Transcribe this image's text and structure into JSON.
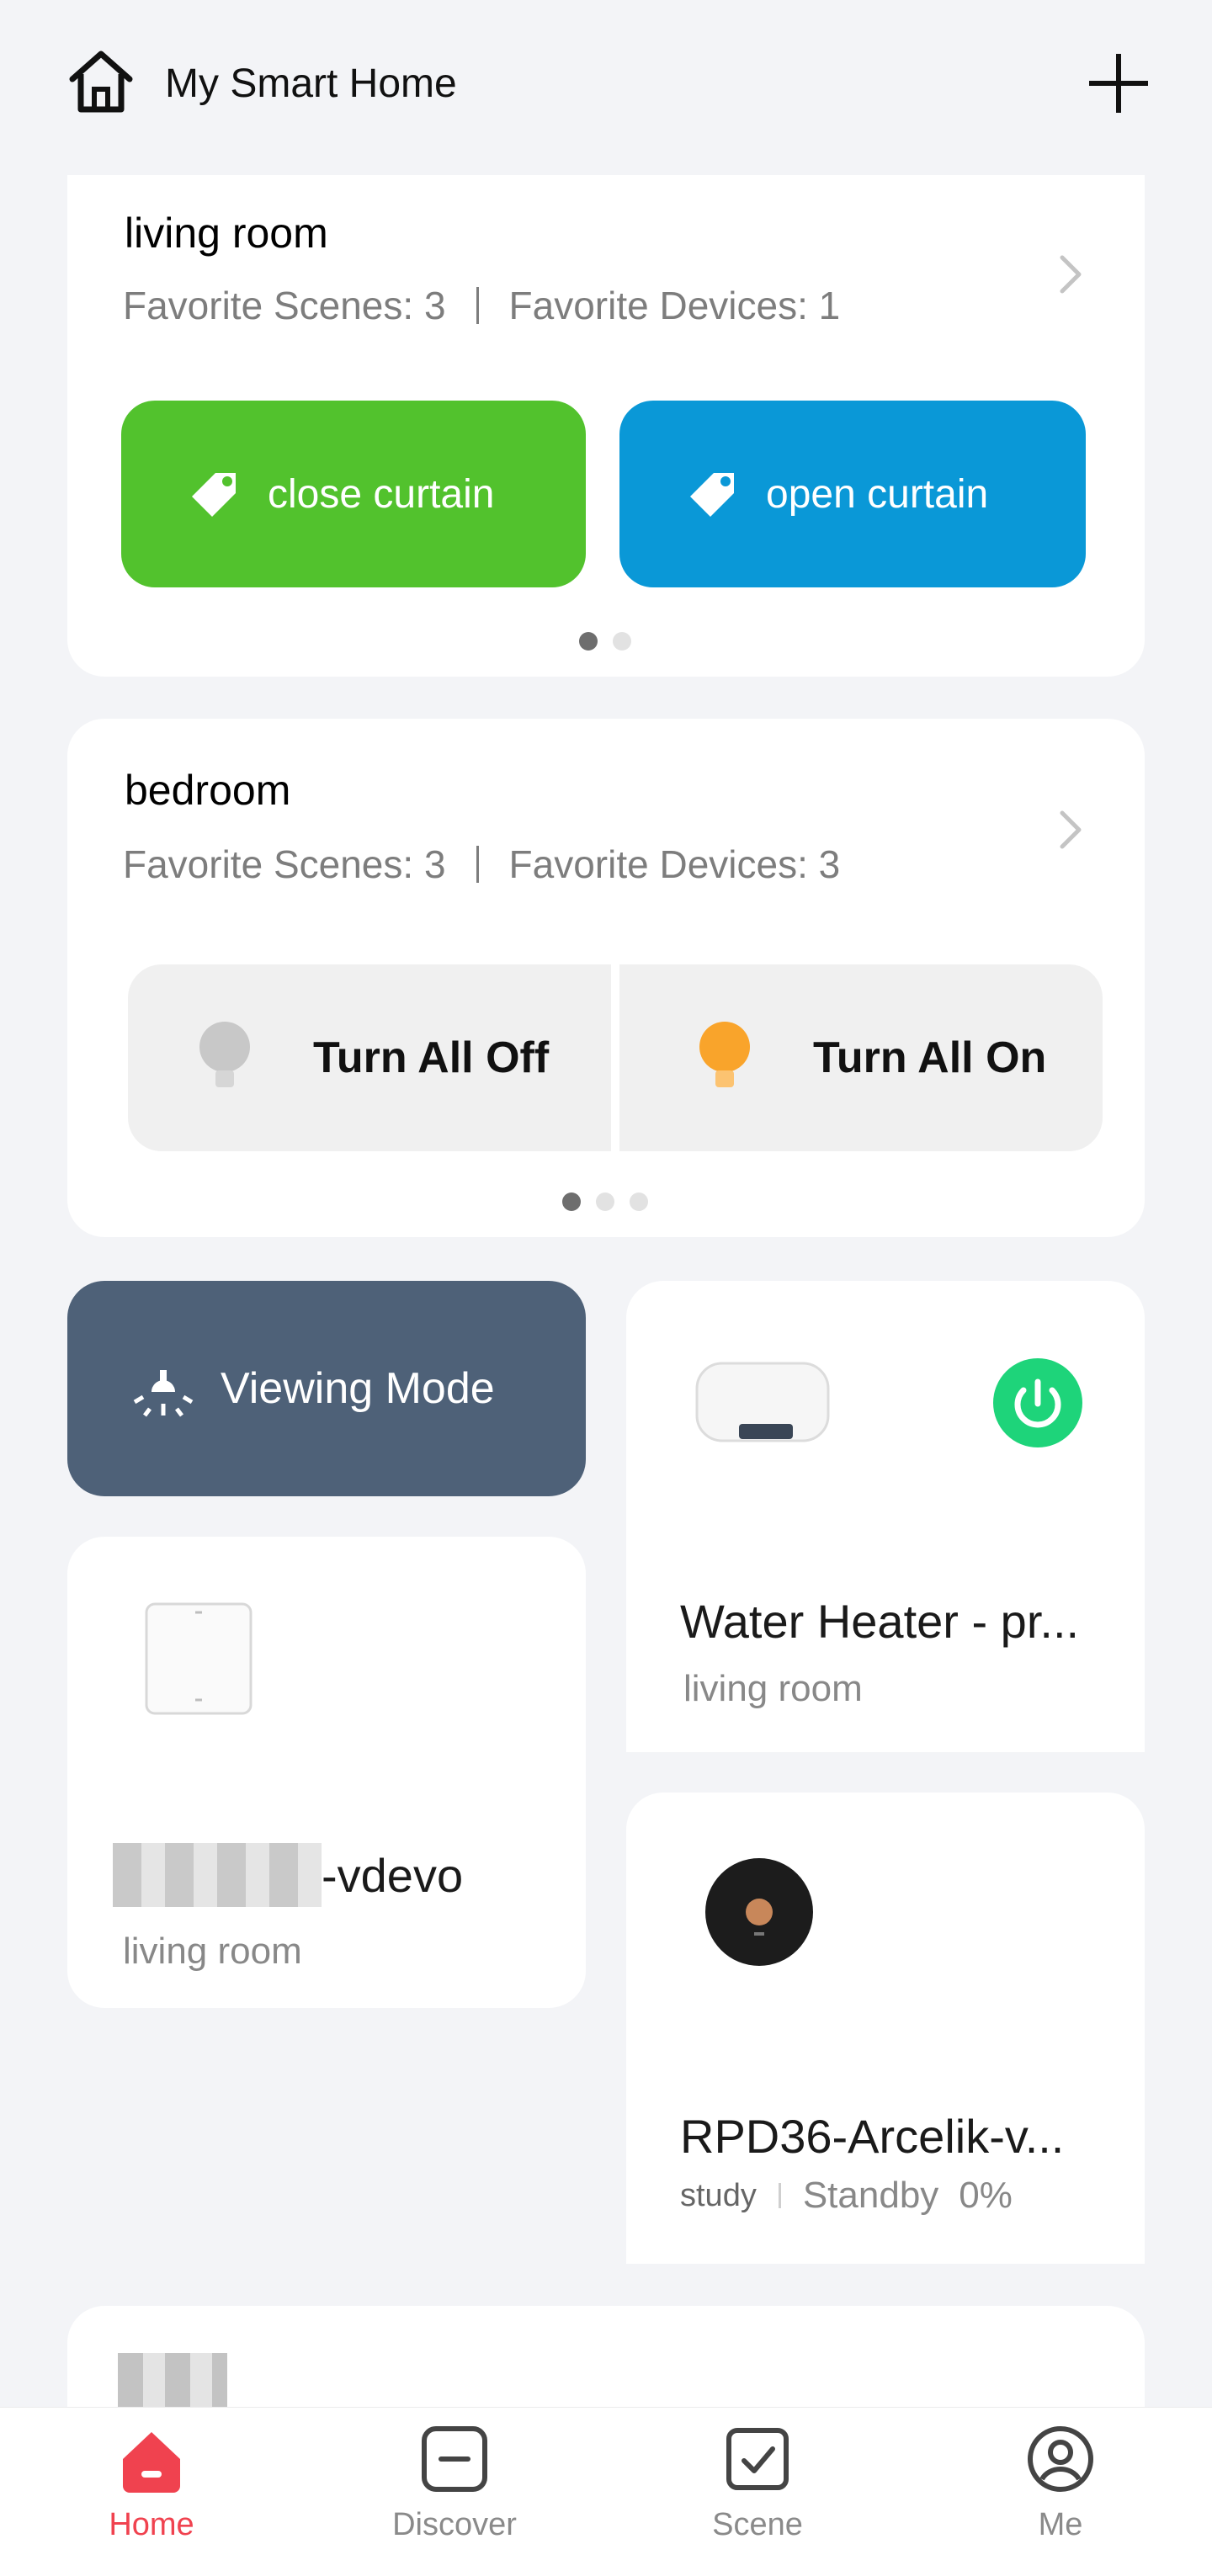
{
  "header": {
    "title": "My Smart Home",
    "home_icon": "home-icon",
    "add_icon": "plus-icon"
  },
  "rooms": [
    {
      "name": "living room",
      "favorite_scenes": "Favorite Scenes: 3",
      "favorite_devices": "Favorite Devices: 1",
      "scenes": [
        {
          "label": "close curtain",
          "color": "#52c22d",
          "icon": "tag-icon"
        },
        {
          "label": "open curtain",
          "color": "#0a98d7",
          "icon": "tag-icon"
        }
      ],
      "pager": {
        "pages": 2,
        "active": 1
      }
    },
    {
      "name": "bedroom",
      "favorite_scenes": "Favorite Scenes: 3",
      "favorite_devices": "Favorite Devices: 3",
      "actions": [
        {
          "label": "Turn All Off",
          "icon": "bulb-off-icon",
          "color": "#c8c8c8"
        },
        {
          "label": "Turn All On",
          "icon": "bulb-on-icon",
          "color": "#f9a42b"
        }
      ],
      "pager": {
        "pages": 3,
        "active": 1
      }
    }
  ],
  "scene_tile": {
    "label": "Viewing Mode",
    "color": "#4e6178",
    "icon": "lamp-icon"
  },
  "devices": [
    {
      "name": "Water Heater - pr...",
      "room": "living room",
      "icon": "water-heater-icon",
      "power_icon": "power-icon",
      "power_color": "#1ed47a"
    },
    {
      "name": "-vdevo",
      "room": "living room",
      "icon": "wall-switch-icon"
    },
    {
      "name": "RPD36-Arcelik-v...",
      "room": "study",
      "status": "Standby",
      "battery": "0%",
      "icon": "robot-vacuum-icon"
    }
  ],
  "tabs": [
    {
      "label": "Home",
      "icon": "home-tab-icon",
      "active": true,
      "color": "#f0424f"
    },
    {
      "label": "Discover",
      "icon": "discover-icon",
      "active": false
    },
    {
      "label": "Scene",
      "icon": "scene-icon",
      "active": false
    },
    {
      "label": "Me",
      "icon": "profile-icon",
      "active": false
    }
  ]
}
